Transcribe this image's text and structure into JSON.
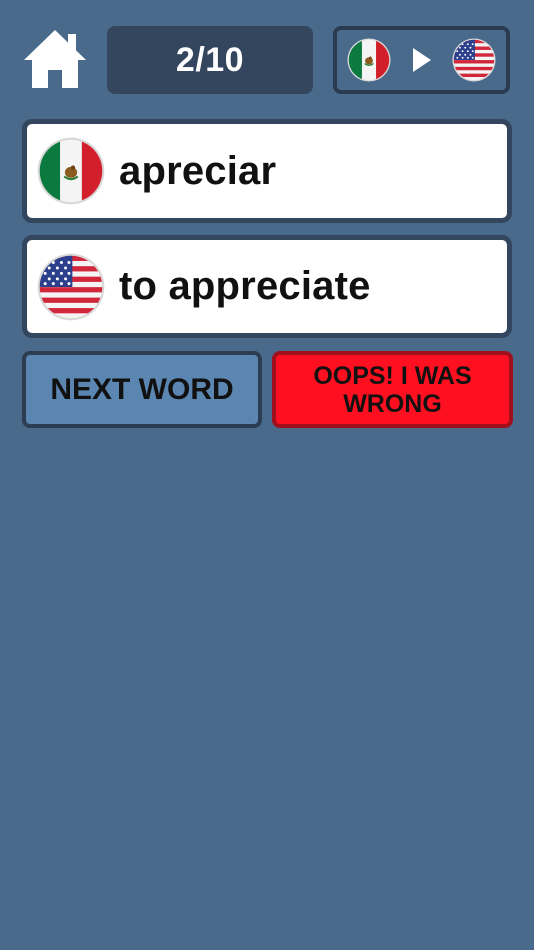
{
  "header": {
    "home_icon": "home-icon",
    "progress_text": "2/10",
    "direction": {
      "from_flag": "mexico-flag-icon",
      "arrow": "play-arrow-icon",
      "to_flag": "usa-flag-icon"
    }
  },
  "cards": [
    {
      "flag": "mexico-flag-icon",
      "text": "apreciar"
    },
    {
      "flag": "usa-flag-icon",
      "text": "to appreciate"
    }
  ],
  "buttons": {
    "next_label": "NEXT WORD",
    "wrong_label": "OOPS! I WAS WRONG"
  },
  "colors": {
    "background": "#4a6a8c",
    "counter_bg": "#34465e",
    "next_button": "#5b86b2",
    "wrong_button": "#ff1020"
  }
}
